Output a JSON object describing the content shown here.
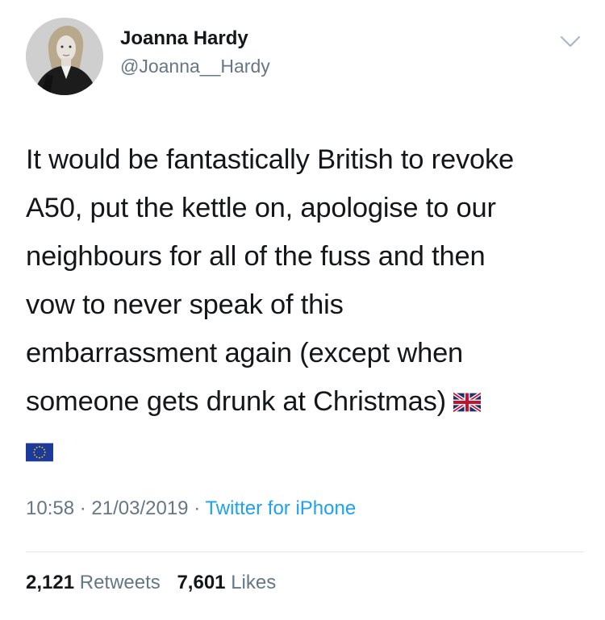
{
  "tweet": {
    "author": {
      "display_name": "Joanna Hardy",
      "handle": "@Joanna__Hardy"
    },
    "text_lines": [
      "It would be fantastically British to revoke",
      "A50, put the kettle on, apologise to our",
      "neighbours for all of the fuss and then",
      "vow to never speak of this",
      "embarrassment again (except when",
      "someone gets drunk at Christmas)"
    ],
    "emoji": [
      "flag-uk-icon",
      "flag-eu-icon"
    ],
    "time": "10:58",
    "date": "21/03/2019",
    "separator": "·",
    "source": "Twitter for iPhone",
    "stats": {
      "retweets_count": "2,121",
      "retweets_label": "Retweets",
      "likes_count": "7,601",
      "likes_label": "Likes"
    },
    "colors": {
      "text": "#14171a",
      "secondary": "#657786",
      "link": "#1da1f2",
      "divider": "#e1e8ed"
    }
  }
}
